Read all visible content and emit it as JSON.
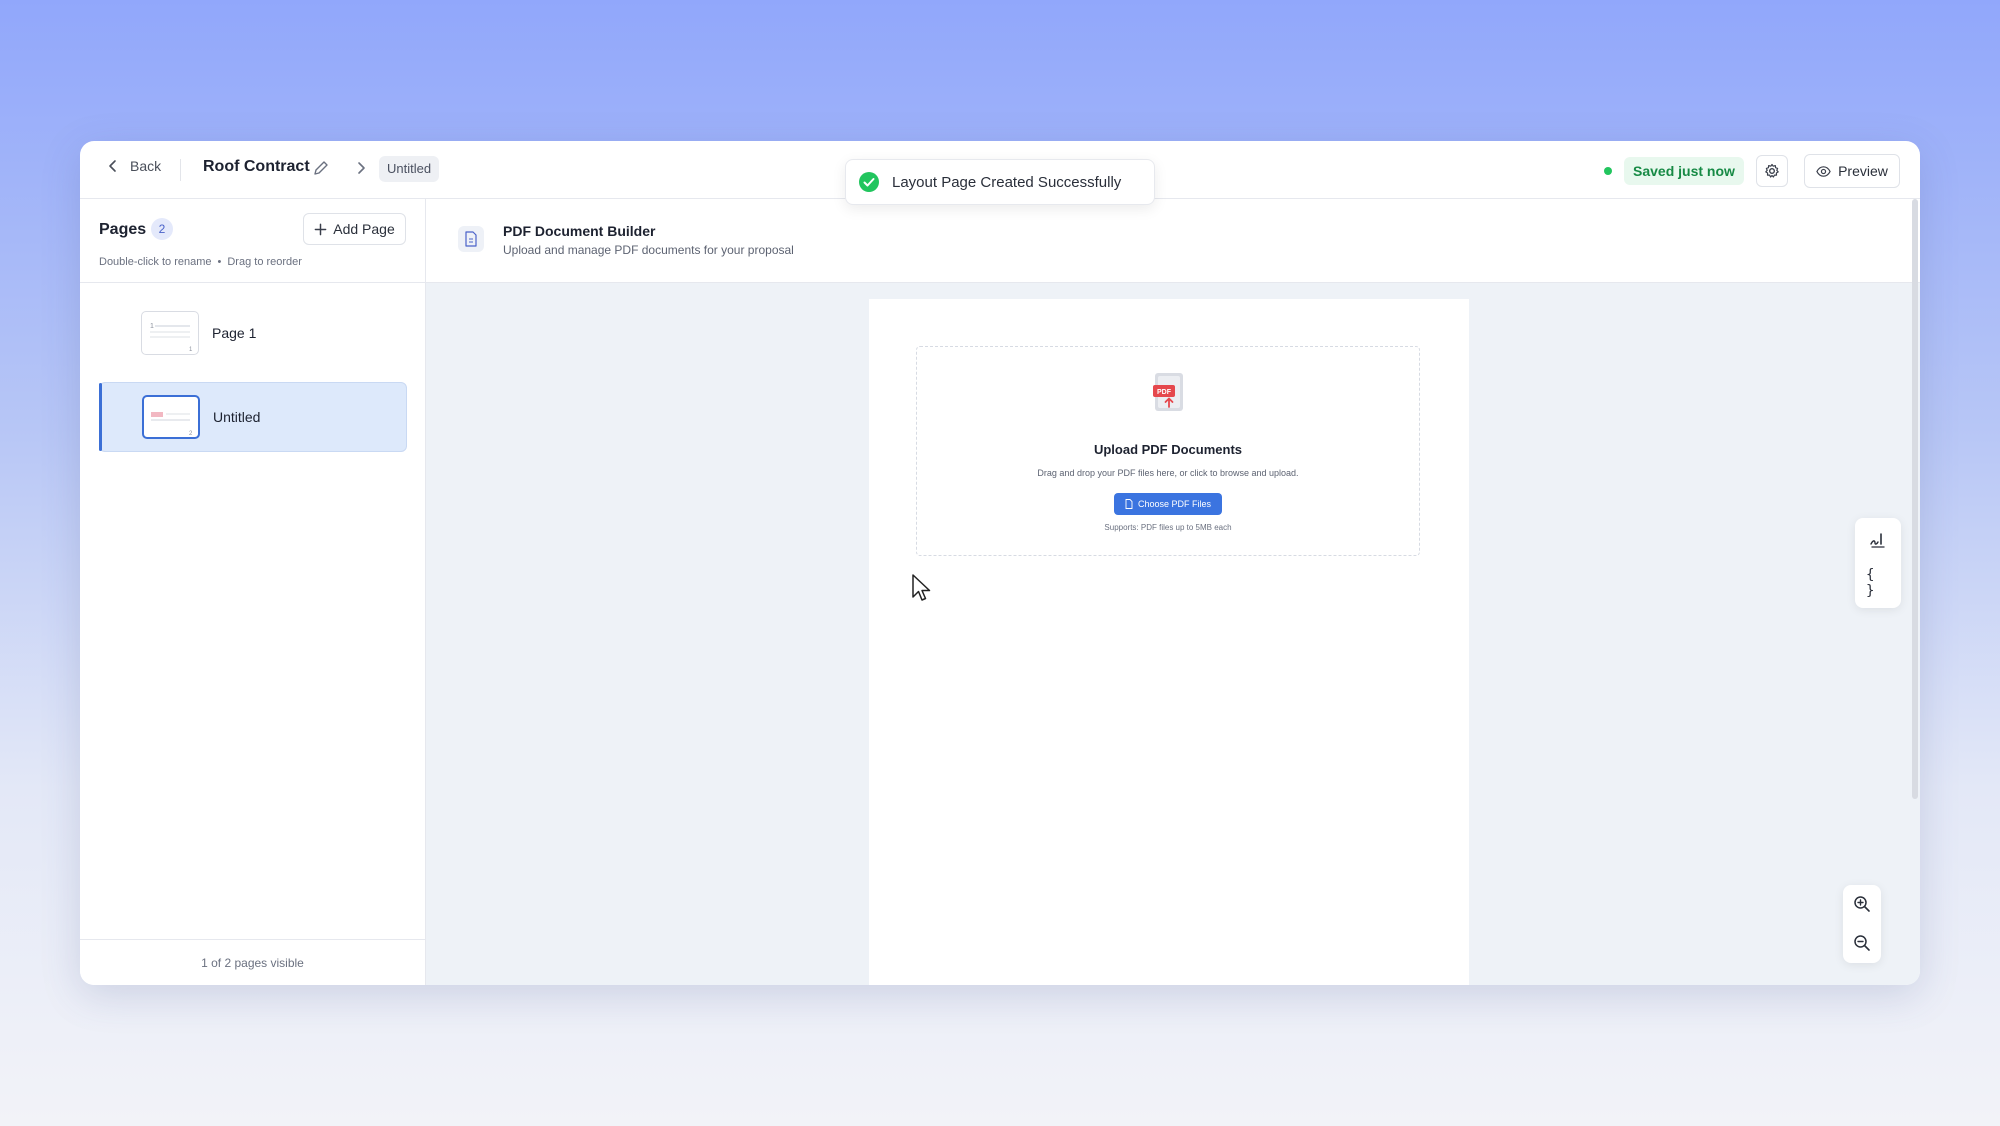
{
  "topbar": {
    "back_label": "Back",
    "doc_title": "Roof Contract",
    "breadcrumb_current": "Untitled",
    "save_status": "Saved just now",
    "preview_label": "Preview",
    "status_color": "#22c55e"
  },
  "toast": {
    "message": "Layout Page Created Successfully",
    "icon": "check-circle-icon"
  },
  "sidebar": {
    "title": "Pages",
    "count": "2",
    "add_page_label": "Add Page",
    "hint_rename": "Double-click to rename",
    "hint_reorder": "Drag to reorder",
    "pages": [
      {
        "label": "Page 1",
        "number": "1",
        "active": false
      },
      {
        "label": "Untitled",
        "number": "2",
        "active": true
      }
    ],
    "footer": "1 of 2 pages visible"
  },
  "main": {
    "title": "PDF Document Builder",
    "subtitle": "Upload and manage PDF documents for your proposal",
    "upload": {
      "title": "Upload PDF Documents",
      "description": "Drag and drop your PDF files here, or click to browse and upload.",
      "button_label": "Choose PDF Files",
      "support_text": "Supports: PDF files up to 5MB each"
    },
    "tools": {
      "signature_icon": "signature-icon",
      "variables_label": "{ }"
    }
  },
  "colors": {
    "accent": "#3b74e0",
    "active_page_bg": "#dde9fb"
  }
}
